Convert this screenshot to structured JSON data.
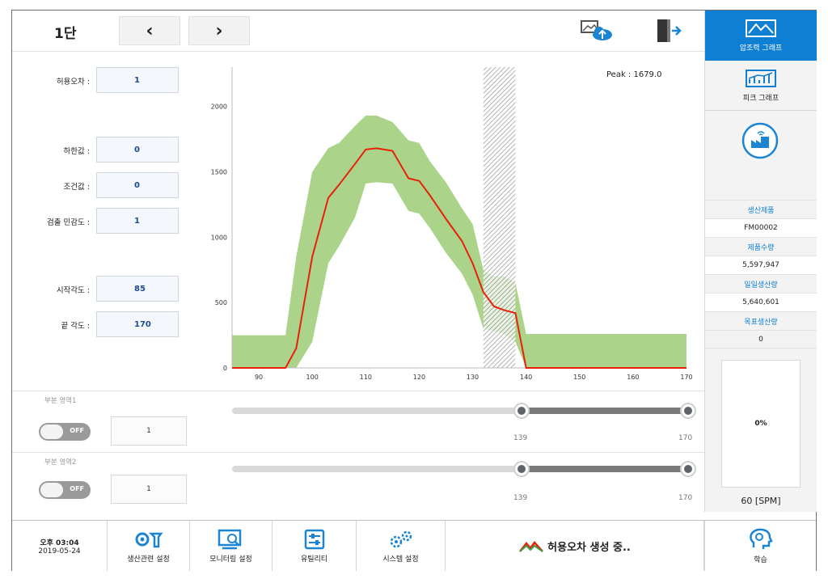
{
  "header": {
    "stage": "1단",
    "prev": "‹",
    "next": "›"
  },
  "right_panel": {
    "btn_pressure_graph": "압조력 그래프",
    "btn_peak_graph": "피크 그래프",
    "rows": [
      "생산제품",
      "FM00002",
      "제품수량",
      "5,597,947",
      "일일생산량",
      "5,640,601",
      "목표생산량",
      "0"
    ],
    "progress_percent": "0%",
    "spm": "60 [SPM]",
    "accent": "#0f7fd3"
  },
  "params": {
    "tolerance": {
      "label": "허용오차 :",
      "value": "1"
    },
    "lower": {
      "label": "하한값 :",
      "value": "0"
    },
    "condition": {
      "label": "조건값 :",
      "value": "0"
    },
    "sensitivity": {
      "label": "검출 민감도 :",
      "value": "1"
    },
    "start_angle": {
      "label": "시작각도 :",
      "value": "85"
    },
    "end_angle": {
      "label": "끝 각도 :",
      "value": "170"
    }
  },
  "chart_data": {
    "type": "line",
    "peak_label": "Peak : 1679.0",
    "x_ticks": [
      "90",
      "100",
      "110",
      "120",
      "130",
      "140",
      "150",
      "160",
      "170"
    ],
    "y_ticks": [
      "0",
      "500",
      "1000",
      "1500",
      "2000"
    ],
    "xlim": [
      85,
      170
    ],
    "ylim": [
      0,
      2300
    ],
    "x": [
      85,
      90,
      95,
      97,
      100,
      103,
      105,
      108,
      110,
      112,
      115,
      118,
      120,
      122,
      125,
      128,
      130,
      132,
      134,
      136,
      138,
      140,
      145,
      150,
      160,
      170
    ],
    "y": [
      0,
      0,
      0,
      150,
      850,
      1300,
      1400,
      1560,
      1670,
      1679,
      1660,
      1450,
      1430,
      1320,
      1140,
      970,
      800,
      580,
      470,
      440,
      420,
      0,
      0,
      0,
      0,
      0
    ],
    "band_upper": [
      250,
      250,
      250,
      850,
      1500,
      1680,
      1720,
      1850,
      1930,
      1930,
      1880,
      1740,
      1720,
      1580,
      1420,
      1220,
      1100,
      750,
      700,
      700,
      650,
      260,
      260,
      260,
      260,
      260
    ],
    "band_lower": [
      0,
      0,
      0,
      0,
      200,
      800,
      930,
      1150,
      1410,
      1420,
      1410,
      1200,
      1180,
      1070,
      880,
      720,
      560,
      300,
      280,
      260,
      200,
      0,
      0,
      0,
      0,
      0
    ],
    "hatch_range": [
      132,
      138
    ],
    "line_color": "#e8200a",
    "band_color": "#9ccd76"
  },
  "zones": [
    {
      "title": "부분 영역1",
      "toggle": "OFF",
      "value": "1",
      "low": "139",
      "high": "170"
    },
    {
      "title": "부분 영역2",
      "toggle": "OFF",
      "value": "1",
      "low": "139",
      "high": "170"
    }
  ],
  "bottom": {
    "time": "오후 03:04",
    "date": "2019-05-24",
    "production_settings": "생산관련 설정",
    "monitoring_settings": "모니터링 설정",
    "utility": "유틸리티",
    "system_settings": "시스템 설정",
    "status": "허용오차 생성 중..",
    "learning": "학습"
  }
}
